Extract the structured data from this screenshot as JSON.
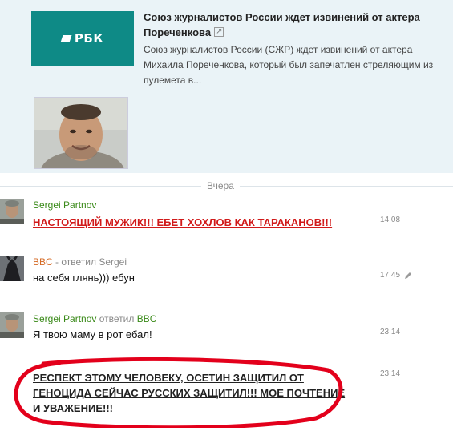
{
  "share": {
    "logo_text": "РБК",
    "title": "Союз журналистов России ждет извинений от актера Пореченкова",
    "description": "Союз журналистов России (СЖР) ждет извинений от актера Михаила Пореченкова, который был запечатлен стреляющим из пулемета в..."
  },
  "feed": {
    "day_separator": "Вчера",
    "messages": [
      {
        "author": "Sergei Partnov",
        "reply_prefix": "",
        "reply_to": "",
        "text": "НАСТОЯЩИЙ МУЖИК!!! ЕБЕТ ХОХЛОВ КАК ТАРАКАНОВ!!!",
        "time": "14:08"
      },
      {
        "author": "BBC",
        "reply_prefix": "- ответил",
        "reply_to": "Sergei",
        "text": "на себя глянь))) ебун",
        "time": "17:45"
      },
      {
        "author": "Sergei Partnov",
        "reply_prefix": "ответил",
        "reply_to": "BBC",
        "text": "Я твою маму в рот ебал!",
        "time": "23:14"
      },
      {
        "author": "",
        "reply_prefix": "",
        "reply_to": "",
        "text": "РЕСПЕКТ ЭТОМУ ЧЕЛОВЕКУ, ОСЕТИН ЗАЩИТИЛ ОТ ГЕНОЦИДА СЕЙЧАС РУССКИХ ЗАЩИТИЛ!!! МОЕ ПОЧТЕНИЕ И УВАЖЕНИЕ!!!",
        "time": "23:14"
      }
    ]
  },
  "colors": {
    "share_bg": "#eaf3f7",
    "rbk_teal": "#0e8a86",
    "author_green": "#3a8a19",
    "author_orange": "#d56b26",
    "alert_red": "#d11a1a",
    "annotation_red": "#e3001b"
  },
  "icons": {
    "external_link": "external-link-icon",
    "edit": "pencil-icon"
  }
}
